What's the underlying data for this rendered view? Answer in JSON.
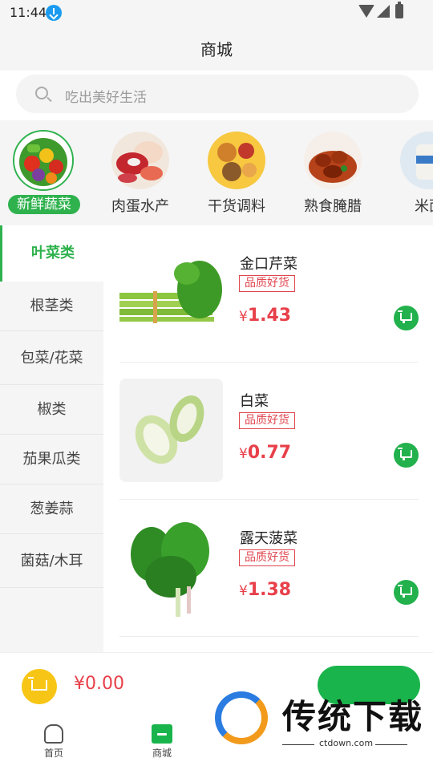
{
  "status_bar": {
    "time": "11:44",
    "icons": [
      "download-icon",
      "wifi-icon",
      "signal-icon",
      "battery-icon"
    ]
  },
  "header": {
    "title": "商城"
  },
  "search": {
    "placeholder": "吃出美好生活"
  },
  "categories": [
    {
      "label": "新鲜蔬菜",
      "active": true
    },
    {
      "label": "肉蛋水产",
      "active": false
    },
    {
      "label": "干货调料",
      "active": false
    },
    {
      "label": "熟食腌腊",
      "active": false
    },
    {
      "label": "米面",
      "active": false
    }
  ],
  "sidebar": {
    "items": [
      {
        "label": "叶菜类",
        "active": true
      },
      {
        "label": "根茎类",
        "active": false
      },
      {
        "label": "包菜/花菜",
        "active": false
      },
      {
        "label": "椒类",
        "active": false
      },
      {
        "label": "茄果瓜类",
        "active": false
      },
      {
        "label": "葱姜蒜",
        "active": false
      },
      {
        "label": "菌菇/木耳",
        "active": false
      }
    ]
  },
  "products": [
    {
      "name": "金口芹菜",
      "badge": "品质好货",
      "currency": "¥",
      "price": "1.43"
    },
    {
      "name": "白菜",
      "badge": "品质好货",
      "currency": "¥",
      "price": "0.77"
    },
    {
      "name": "露天菠菜",
      "badge": "品质好货",
      "currency": "¥",
      "price": "1.38"
    }
  ],
  "cart": {
    "total": "¥0.00"
  },
  "bottom_nav": [
    {
      "label": "首页",
      "icon": "home-icon"
    },
    {
      "label": "商城",
      "icon": "shop-icon",
      "active": true
    }
  ],
  "watermark": {
    "text": "传统下载",
    "url": "ctdown.com"
  },
  "colors": {
    "accent": "#2fb24e",
    "price": "#e8404a",
    "badge": "#e0464e",
    "coin": "#f7c515"
  }
}
